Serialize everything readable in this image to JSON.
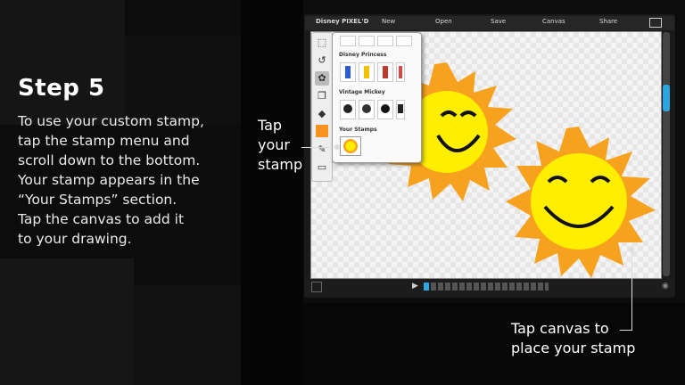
{
  "slide": {
    "title": "Step 5",
    "body_lines": [
      "To use your custom stamp,",
      "tap the stamp menu and",
      "scroll down to the bottom.",
      "Your stamp appears in the",
      "“Your Stamps” section.",
      "Tap the canvas to add it",
      "to your drawing."
    ]
  },
  "callouts": {
    "stamp_lines": [
      "Tap",
      "your",
      "stamp"
    ],
    "canvas_lines": [
      "Tap canvas to",
      "place your stamp"
    ]
  },
  "app": {
    "logo": "Disney PIXEL'D",
    "menu": {
      "new": "New",
      "open": "Open",
      "save": "Save",
      "canvas": "Canvas",
      "share": "Share"
    },
    "stamp_panel": {
      "section_princess": "Disney Princess",
      "section_mickey": "Vintage Mickey",
      "section_yours": "Your Stamps"
    },
    "colors": {
      "current_color": "#f7931e",
      "sun_yellow": "#ffee00",
      "sun_rays": "#f7a21e",
      "accent": "#2aa7e0"
    }
  }
}
